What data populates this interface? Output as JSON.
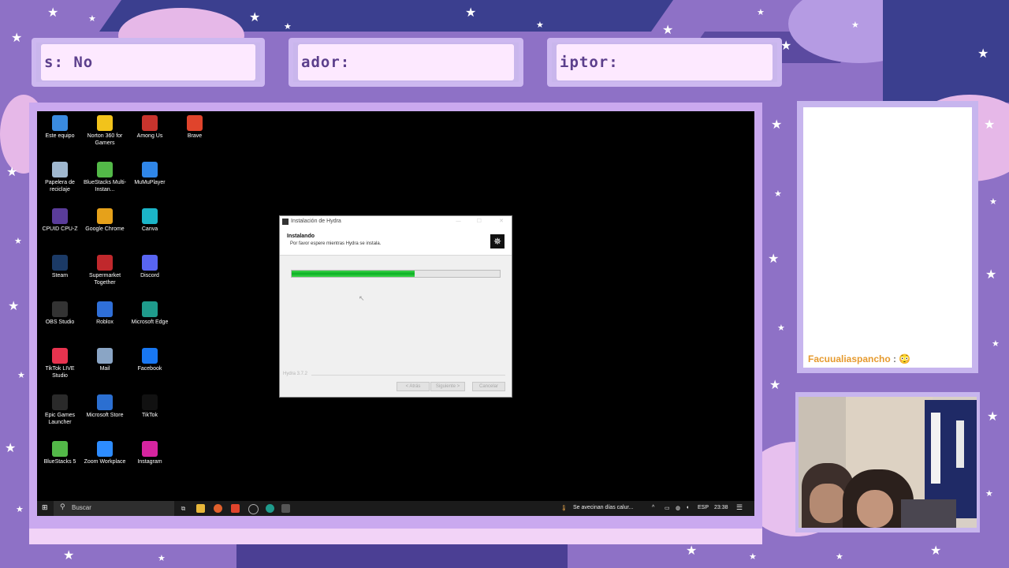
{
  "overlay": {
    "top_bars": [
      {
        "text": "s: No"
      },
      {
        "text": "ador:"
      },
      {
        "text": "iptor:"
      }
    ],
    "chat": {
      "username": "Facuualiaspancho",
      "separator": ":",
      "emoji": "😳"
    }
  },
  "desktop": {
    "icons": [
      {
        "label": "Este equipo",
        "icon": "computer-icon",
        "color": "#3a8be0"
      },
      {
        "label": "Norton 360 for Gamers",
        "icon": "norton-icon",
        "color": "#f2c31b"
      },
      {
        "label": "Among Us",
        "icon": "among-us-icon",
        "color": "#c8342d"
      },
      {
        "label": "Brave",
        "icon": "brave-icon",
        "color": "#e0442c"
      },
      {
        "label": "Papelera de reciclaje",
        "icon": "recycle-bin-icon",
        "color": "#9fb7cf"
      },
      {
        "label": "BlueStacks Multi-Instan...",
        "icon": "bluestacks-icon",
        "color": "#53b948"
      },
      {
        "label": "MuMuPlayer",
        "icon": "mumu-icon",
        "color": "#2f86e8"
      },
      {
        "label": "CPUID CPU-Z",
        "icon": "cpuz-icon",
        "color": "#5a3c9a"
      },
      {
        "label": "Google Chrome",
        "icon": "chrome-icon",
        "color": "#e6a11a"
      },
      {
        "label": "Canva",
        "icon": "canva-icon",
        "color": "#1bb5c8"
      },
      {
        "label": "Steam",
        "icon": "steam-icon",
        "color": "#1b3a66"
      },
      {
        "label": "Supermarket Together",
        "icon": "supermarket-icon",
        "color": "#c0282c"
      },
      {
        "label": "Discord",
        "icon": "discord-icon",
        "color": "#5865f2"
      },
      {
        "label": "OBS Studio",
        "icon": "obs-icon",
        "color": "#333333"
      },
      {
        "label": "Roblox",
        "icon": "roblox-icon",
        "color": "#2f6fd8"
      },
      {
        "label": "Microsoft Edge",
        "icon": "edge-icon",
        "color": "#1f9b8c"
      },
      {
        "label": "TikTok LIVE Studio",
        "icon": "tiktok-live-icon",
        "color": "#e8334f"
      },
      {
        "label": "Mail",
        "icon": "mail-icon",
        "color": "#8aa5c5"
      },
      {
        "label": "Facebook",
        "icon": "facebook-icon",
        "color": "#1877f2"
      },
      {
        "label": "Epic Games Launcher",
        "icon": "epic-games-icon",
        "color": "#2a2a2a"
      },
      {
        "label": "Microsoft Store",
        "icon": "store-icon",
        "color": "#2b6fd1"
      },
      {
        "label": "TikTok",
        "icon": "tiktok-icon",
        "color": "#111111"
      },
      {
        "label": "BlueStacks 5",
        "icon": "bluestacks5-icon",
        "color": "#53b948"
      },
      {
        "label": "Zoom Workplace",
        "icon": "zoom-icon",
        "color": "#2d8cff"
      },
      {
        "label": "Instagram",
        "icon": "instagram-icon",
        "color": "#d6249f"
      }
    ]
  },
  "installer": {
    "window_title": "Instalación de Hydra",
    "heading": "Instalando",
    "subheading": "Por favor espere mientras Hydra se instala.",
    "progress": 0.59,
    "version": "Hydra 3.7.2",
    "buttons": {
      "back": "< Atrás",
      "next": "Siguiente >",
      "cancel": "Cancelar"
    }
  },
  "taskbar": {
    "search_placeholder": "Buscar",
    "weather": "Se avecinan días calur...",
    "language": "ESP",
    "time": "23:38"
  }
}
